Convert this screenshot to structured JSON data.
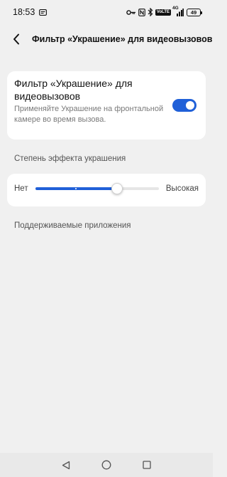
{
  "status_bar": {
    "time": "18:53",
    "volte_label": "VoLTE",
    "network_label": "4G",
    "battery": "49",
    "icons": [
      "message-icon",
      "key-icon",
      "nfc-icon",
      "bluetooth-icon",
      "volte-icon",
      "signal-icon",
      "battery-icon"
    ]
  },
  "header": {
    "title": "Фильтр «Украшение» для видеовызовов"
  },
  "filter_card": {
    "title": "Фильтр «Украшение» для видеовызовов",
    "description": "Применяйте Украшение на фронтальной камере во время вызова.",
    "enabled": true
  },
  "degree_section": {
    "label": "Степень эффекта украшения",
    "min_label": "Нет",
    "max_label": "Высокая",
    "value_percent": 66
  },
  "apps_section": {
    "label": "Поддерживаемые приложения"
  },
  "colors": {
    "accent": "#2060d8",
    "background": "#f0f0f0",
    "card": "#ffffff"
  }
}
